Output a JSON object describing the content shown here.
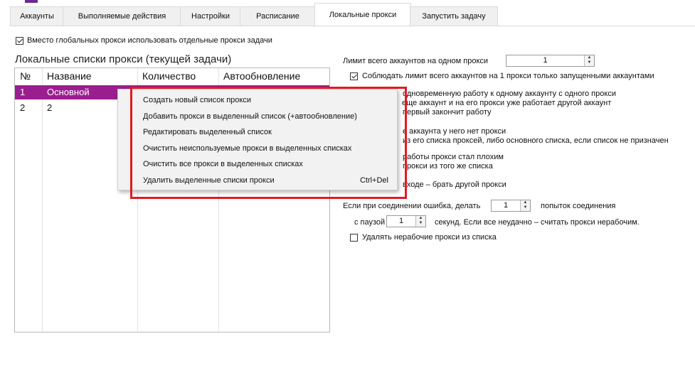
{
  "tabs": [
    {
      "label": "Аккаунты"
    },
    {
      "label": "Выполняемые действия"
    },
    {
      "label": "Настройки"
    },
    {
      "label": "Расписание"
    },
    {
      "label": "Локальные прокси"
    },
    {
      "label": "Запустить задачу"
    }
  ],
  "use_local_proxies": {
    "label": "Вместо глобальных прокси использовать отдельные прокси задачи",
    "checked": true
  },
  "local_lists": {
    "title": "Локальные списки прокси (текущей задачи)",
    "columns": [
      "№",
      "Название",
      "Количество",
      "Автообновление"
    ],
    "rows": [
      {
        "num": "1",
        "name": "Основной",
        "selected": true
      },
      {
        "num": "2",
        "name": "2",
        "selected": false
      }
    ]
  },
  "context_menu": {
    "items": [
      {
        "label": "Создать новый список прокси",
        "shortcut": ""
      },
      {
        "label": "Добавить прокси в выделенный список (+автообновление)",
        "shortcut": ""
      },
      {
        "label": "Редактировать выделенный список",
        "shortcut": ""
      },
      {
        "label": "Очистить неиспользуемые прокси в выделенных списках",
        "shortcut": ""
      },
      {
        "label": "Очистить все прокси в выделенных списках",
        "shortcut": ""
      },
      {
        "label": "Удалить выделенные списки прокси",
        "shortcut": "Ctrl+Del"
      }
    ]
  },
  "settings": {
    "limit_label": "Лимит всего аккаунтов на одном прокси",
    "limit_value": "1",
    "limit_running_label": "Соблюдать лимит всего аккаунтов на 1 прокси только запущенными аккаунтами",
    "limit_running_checked": true,
    "fragments": [
      "одновременную работу к одному аккаунту с одного прокси",
      "еще аккаунт и на его прокси уже работает другой аккаунт",
      "первый закончит работу",
      "е аккаунта у него нет прокси",
      "из его списка проксей, либо основного списка, если список не призначен",
      "работы прокси стал плохим",
      "прокси из того же списка",
      "входе – брать другой прокси"
    ],
    "retry_prefix": "Если при соединении ошибка, делать",
    "retry_value": "1",
    "retry_suffix": "попыток соединения",
    "pause_prefix": "с паузой",
    "pause_value": "1",
    "pause_suffix": "секунд. Если все неудачно – считать прокси нерабочим.",
    "remove_bad_label": "Удалять нерабочие прокси из списка",
    "remove_bad_checked": false
  }
}
